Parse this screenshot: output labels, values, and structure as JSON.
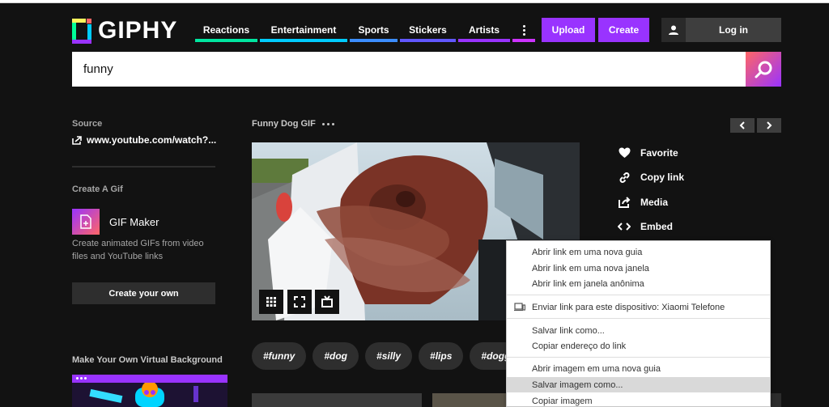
{
  "header": {
    "logo_text": "GIPHY",
    "nav": [
      {
        "label": "Reactions",
        "color": "#00e6a0"
      },
      {
        "label": "Entertainment",
        "color": "#00ccff"
      },
      {
        "label": "Sports",
        "color": "#6157ff"
      },
      {
        "label": "Stickers",
        "color": "#9933ff"
      },
      {
        "label": "Artists",
        "color": "#9933ff"
      }
    ],
    "more_icon": "kebab-icon",
    "upload_label": "Upload",
    "create_label": "Create",
    "login_label": "Log in"
  },
  "search": {
    "value": "funny",
    "icon": "search-icon"
  },
  "sidebar": {
    "source_label": "Source",
    "source_link": "www.youtube.com/watch?...",
    "create_gif_label": "Create A Gif",
    "gif_maker_title": "GIF Maker",
    "gif_maker_desc": "Create animated GIFs from video files and YouTube links",
    "create_own_label": "Create your own",
    "virtual_bg_title": "Make Your Own Virtual Background"
  },
  "gif": {
    "title": "Funny Dog GIF",
    "controls": [
      "grid-icon",
      "fullscreen-icon",
      "tv-icon"
    ]
  },
  "tags": [
    "#funny",
    "#dog",
    "#silly",
    "#lips",
    "#dogge"
  ],
  "actions": [
    {
      "label": "Favorite",
      "icon": "heart-icon"
    },
    {
      "label": "Copy link",
      "icon": "link-icon"
    },
    {
      "label": "Media",
      "icon": "share-icon"
    },
    {
      "label": "Embed",
      "icon": "code-icon"
    }
  ],
  "context_menu": {
    "items": [
      "Abrir link em uma nova guia",
      "Abrir link em uma nova janela",
      "Abrir link em janela anônima",
      "Enviar link para este dispositivo: Xiaomi Telefone",
      "Salvar link como...",
      "Copiar endereço do link",
      "Abrir imagem em uma nova guia",
      "Salvar imagem como...",
      "Copiar imagem"
    ],
    "highlighted_index": 7
  },
  "colors": {
    "accent": "#9933ff",
    "background": "#121212"
  }
}
